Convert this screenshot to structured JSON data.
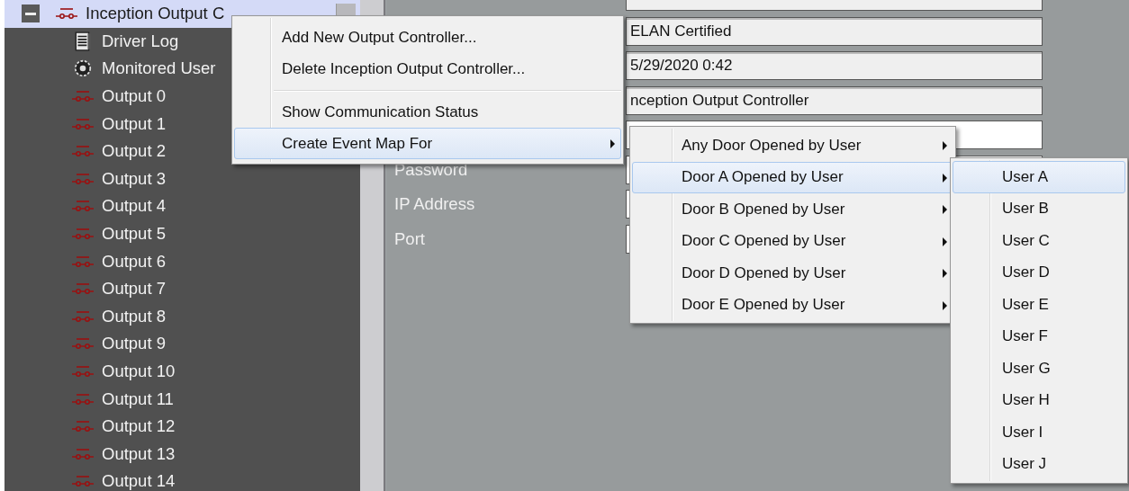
{
  "tree": {
    "root": {
      "label": "Inception Output C",
      "expanded": true,
      "selected": true,
      "children": [
        {
          "label": "Driver Log",
          "kind": "log"
        },
        {
          "label": "Monitored User",
          "kind": "gear"
        },
        {
          "label": "Output 0",
          "kind": "output"
        },
        {
          "label": "Output 1",
          "kind": "output"
        },
        {
          "label": "Output 2",
          "kind": "output"
        },
        {
          "label": "Output 3",
          "kind": "output"
        },
        {
          "label": "Output 4",
          "kind": "output"
        },
        {
          "label": "Output 5",
          "kind": "output"
        },
        {
          "label": "Output 6",
          "kind": "output"
        },
        {
          "label": "Output 7",
          "kind": "output"
        },
        {
          "label": "Output 8",
          "kind": "output"
        },
        {
          "label": "Output 9",
          "kind": "output"
        },
        {
          "label": "Output 10",
          "kind": "output"
        },
        {
          "label": "Output 11",
          "kind": "output"
        },
        {
          "label": "Output 12",
          "kind": "output"
        },
        {
          "label": "Output 13",
          "kind": "output"
        },
        {
          "label": "Output 14",
          "kind": "output"
        }
      ]
    }
  },
  "form": {
    "rows": [
      {
        "kind": "readonly"
      },
      {
        "kind": "readonly",
        "value": "ELAN Certified"
      },
      {
        "kind": "readonly",
        "value": "5/29/2020 0:42"
      },
      {
        "kind": "readonly",
        "value": "nception Output Controller"
      },
      {
        "kind": "editable"
      },
      {
        "kind": "editable",
        "label": "Password"
      },
      {
        "kind": "editable",
        "label": "IP Address"
      },
      {
        "kind": "editable",
        "label": "Port"
      }
    ]
  },
  "context_menu": {
    "items": [
      {
        "kind": "item",
        "label": "Add New Output Controller...",
        "selected": false
      },
      {
        "kind": "item",
        "label": "Delete Inception Output Controller...",
        "selected": false
      },
      {
        "kind": "separator"
      },
      {
        "kind": "item",
        "label": "Show Communication Status",
        "selected": false
      },
      {
        "kind": "submenu",
        "label": "Create Event Map For",
        "selected": true
      }
    ]
  },
  "submenu": {
    "items": [
      {
        "kind": "submenu",
        "label": "Any Door Opened by User",
        "selected": false
      },
      {
        "kind": "submenu",
        "label": "Door A Opened by User",
        "selected": true
      },
      {
        "kind": "submenu",
        "label": "Door B Opened by User",
        "selected": false
      },
      {
        "kind": "submenu",
        "label": "Door C Opened by User",
        "selected": false
      },
      {
        "kind": "submenu",
        "label": "Door D Opened by User",
        "selected": false
      },
      {
        "kind": "submenu",
        "label": "Door E Opened by User",
        "selected": false
      }
    ]
  },
  "user_menu": {
    "items": [
      {
        "label": "User A",
        "selected": true
      },
      {
        "label": "User B",
        "selected": false
      },
      {
        "label": "User C",
        "selected": false
      },
      {
        "label": "User D",
        "selected": false
      },
      {
        "label": "User E",
        "selected": false
      },
      {
        "label": "User F",
        "selected": false
      },
      {
        "label": "User G",
        "selected": false
      },
      {
        "label": "User H",
        "selected": false
      },
      {
        "label": "User I",
        "selected": false
      },
      {
        "label": "User J",
        "selected": false
      }
    ]
  }
}
